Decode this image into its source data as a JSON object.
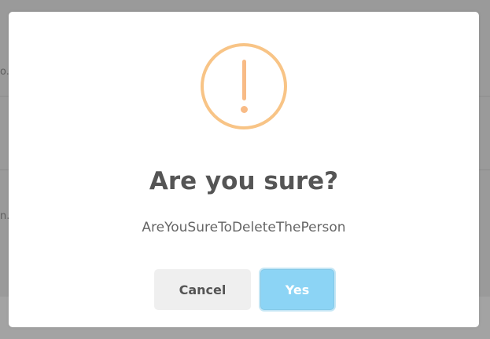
{
  "background": {
    "partial_text_1": "o.c",
    "partial_text_2": "n.c"
  },
  "dialog": {
    "icon": "warning-exclamation-icon",
    "icon_color": "#f8bb86",
    "title": "Are you sure?",
    "message": "AreYouSureToDeleteThePerson",
    "cancel_label": "Cancel",
    "confirm_label": "Yes",
    "confirm_color": "#8cd4f5"
  }
}
